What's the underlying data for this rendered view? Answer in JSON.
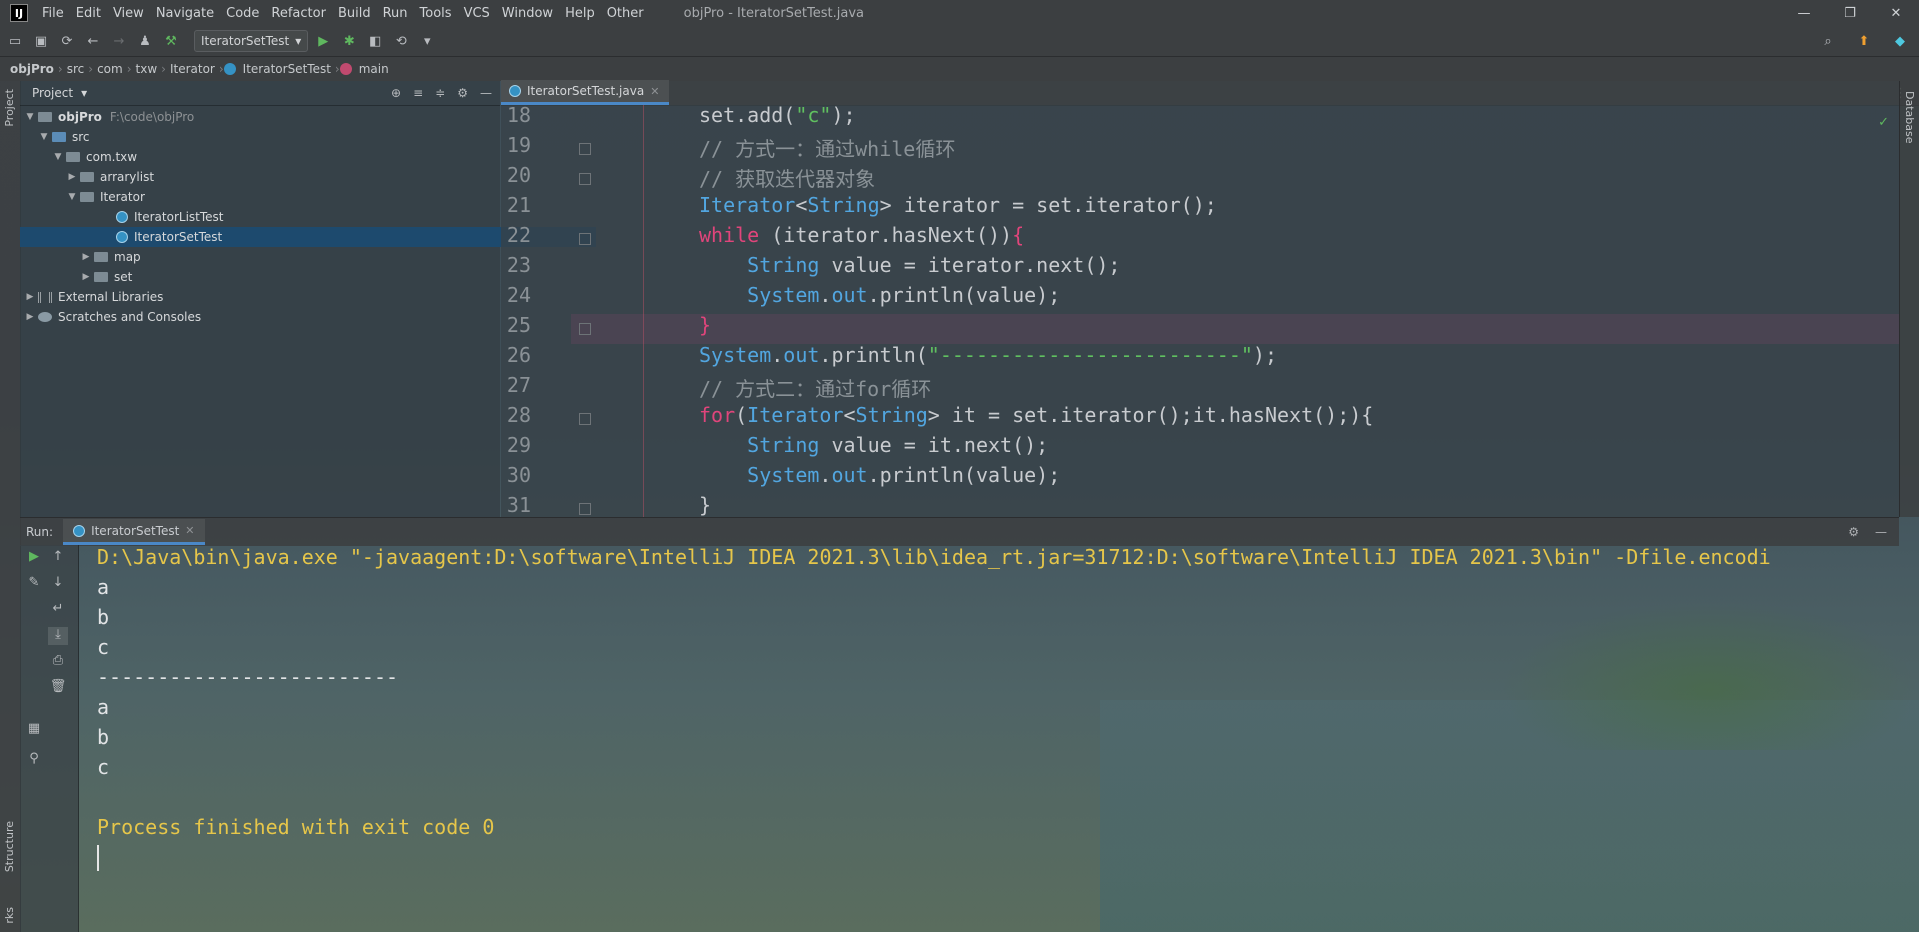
{
  "app": {
    "logo": "IJ",
    "window_title": "objPro - IteratorSetTest.java",
    "menu": [
      "File",
      "Edit",
      "View",
      "Navigate",
      "Code",
      "Refactor",
      "Build",
      "Run",
      "Tools",
      "VCS",
      "Window",
      "Help",
      "Other"
    ],
    "window_controls": [
      "—",
      "❐",
      "✕"
    ]
  },
  "toolbar": {
    "run_config": "IteratorSetTest"
  },
  "breadcrumb": [
    "objPro",
    "src",
    "com",
    "txw",
    "Iterator",
    "IteratorSetTest",
    "main"
  ],
  "left_stripe": {
    "project": "Project",
    "structure": "Structure",
    "bookmarks": "rks"
  },
  "right_stripe": {
    "database": "Database"
  },
  "project": {
    "title": "Project",
    "tree": [
      {
        "label": "objPro",
        "path": "F:\\code\\objPro"
      },
      {
        "label": "src"
      },
      {
        "label": "com.txw"
      },
      {
        "label": "arrarylist"
      },
      {
        "label": "Iterator"
      },
      {
        "label": "IteratorListTest"
      },
      {
        "label": "IteratorSetTest"
      },
      {
        "label": "map"
      },
      {
        "label": "set"
      },
      {
        "label": "External Libraries"
      },
      {
        "label": "Scratches and Consoles"
      }
    ]
  },
  "editor": {
    "tab": "IteratorSetTest.java",
    "line_numbers": [
      "18",
      "19",
      "20",
      "21",
      "22",
      "23",
      "24",
      "25",
      "26",
      "27",
      "28",
      "29",
      "30",
      "31"
    ]
  },
  "run": {
    "label": "Run:",
    "tab": "IteratorSetTest",
    "console": [
      "D:\\Java\\bin\\java.exe \"-javaagent:D:\\software\\IntelliJ IDEA 2021.3\\lib\\idea_rt.jar=31712:D:\\software\\IntelliJ IDEA 2021.3\\bin\" -Dfile.encodi",
      "a",
      "b",
      "c",
      "-------------------------",
      "a",
      "b",
      "c",
      "",
      "Process finished with exit code 0"
    ]
  },
  "colors": {
    "keyword": "#e0457b",
    "type": "#52a6e0",
    "string": "#60c060",
    "comment": "#8a9297",
    "console_highlight": "#e6c64a",
    "selection": "#1d4a6e"
  }
}
